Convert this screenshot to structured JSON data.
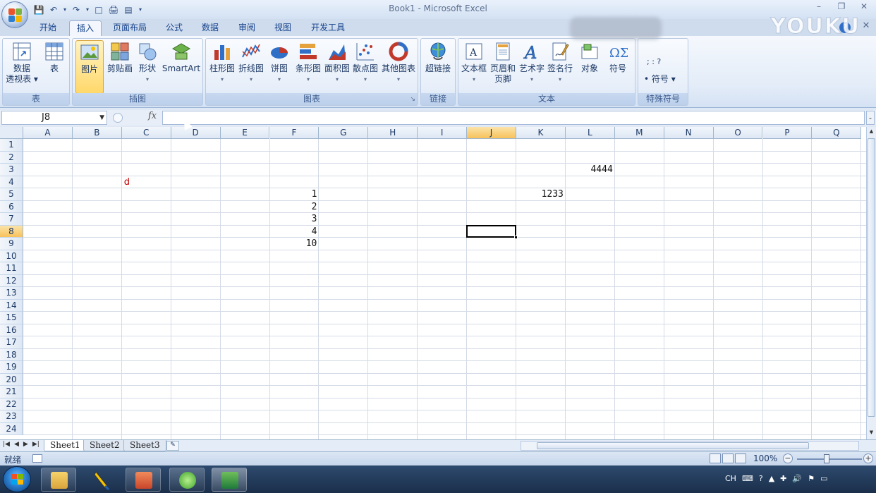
{
  "window": {
    "title": "Book1 - Microsoft Excel",
    "watermark": "YOUKU",
    "ctrl_min": "–",
    "ctrl_restore": "❐",
    "ctrl_close": "✕"
  },
  "qat": [
    "💾",
    "↶",
    "▾",
    "↷",
    "▾",
    "□",
    "🖨",
    "▤",
    "▾"
  ],
  "tabs": [
    "开始",
    "插入",
    "页面布局",
    "公式",
    "数据",
    "审阅",
    "视图",
    "开发工具"
  ],
  "active_tab": "插入",
  "tab_help": "?",
  "tab_close": "✕",
  "ribbon": {
    "groups": {
      "table": "表",
      "illustrations": "插图",
      "charts": "图表",
      "links": "链接",
      "text": "文本",
      "special": "特殊符号"
    },
    "buttons": {
      "pivot": [
        "数据",
        "透视表 ▾"
      ],
      "table": "表",
      "picture": "图片",
      "clipart": "剪贴画",
      "shapes": "形状",
      "smartart": "SmartArt",
      "column": "柱形图",
      "line": "折线图",
      "pie": "饼图",
      "bar": "条形图",
      "area": "面积图",
      "scatter": "散点图",
      "other": "其他图表",
      "hyperlink": "超链接",
      "textbox": "文本框",
      "header": [
        "页眉和",
        "页脚"
      ],
      "wordart": "艺术字",
      "signature": "签名行",
      "object": "对象",
      "symbol": "符号",
      "special_symbols": "• 符号 ▾",
      "special_row1": ";  :  ?"
    },
    "launcher": "↘",
    "dropdown_arrow": "▾"
  },
  "formula_bar": {
    "name_box": "J8",
    "name_arrow": "▼",
    "fx": "fx",
    "formula": "",
    "expand": "⌄"
  },
  "columns": [
    "A",
    "B",
    "C",
    "D",
    "E",
    "F",
    "G",
    "H",
    "I",
    "J",
    "K",
    "L",
    "M",
    "N",
    "O",
    "P",
    "Q"
  ],
  "rows": [
    "1",
    "2",
    "3",
    "4",
    "5",
    "6",
    "7",
    "8",
    "9",
    "10",
    "11",
    "12",
    "13",
    "14",
    "15",
    "16",
    "17",
    "18",
    "19",
    "20",
    "21",
    "22",
    "23",
    "24"
  ],
  "active_cell": {
    "column": "J",
    "row": "8"
  },
  "cells": [
    {
      "ref": "L3",
      "value": "4444"
    },
    {
      "ref": "C4",
      "value": "d",
      "color": "#c00000"
    },
    {
      "ref": "F5",
      "value": "1"
    },
    {
      "ref": "K5",
      "value": "1233"
    },
    {
      "ref": "F6",
      "value": "2"
    },
    {
      "ref": "F7",
      "value": "3"
    },
    {
      "ref": "F8",
      "value": "4"
    },
    {
      "ref": "F9",
      "value": "10"
    }
  ],
  "sheets": [
    "Sheet1",
    "Sheet2",
    "Sheet3"
  ],
  "active_sheet": "Sheet1",
  "sheet_nav": [
    "|◀",
    "◀",
    "▶",
    "▶|"
  ],
  "new_sheet": "✎",
  "status": {
    "ready": "就绪",
    "zoom": "100%",
    "zoom_minus": "−",
    "zoom_plus": "+"
  },
  "tray": [
    "CH",
    "⌨",
    "?",
    "▲",
    "✚",
    "🔊",
    "⚑",
    "▭"
  ],
  "colors": {
    "accent": "#15428b",
    "active_header": "#f7c25b",
    "selected_button": "#ffd86b"
  }
}
